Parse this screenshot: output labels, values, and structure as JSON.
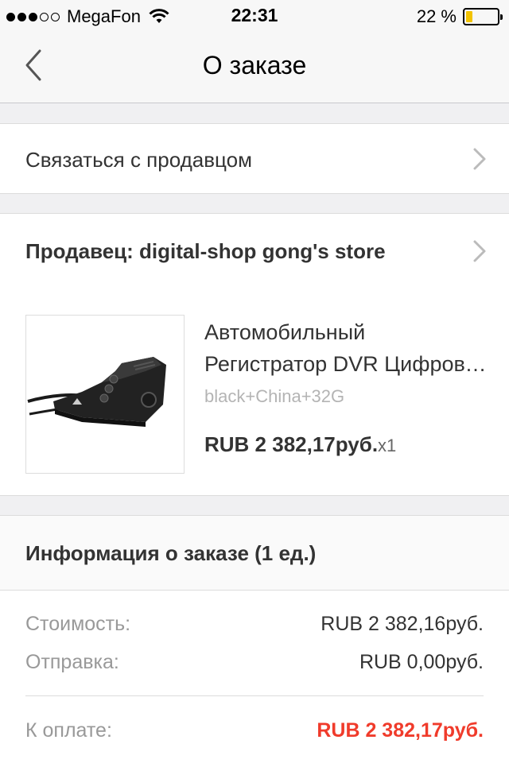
{
  "status_bar": {
    "carrier": "MegaFon",
    "time": "22:31",
    "battery_text": "22 %",
    "battery_level": 0.22,
    "signal_bars": 3,
    "signal_total": 5
  },
  "nav": {
    "title": "О заказе",
    "back_icon": "chevron-left-icon"
  },
  "contact_seller": {
    "label": "Связаться с продавцом"
  },
  "seller": {
    "label": "Продавец: digital-shop gong's store"
  },
  "product": {
    "title_line1": "Автомобильный",
    "title_line2": "Регистратор DVR Цифровой",
    "variant": "black+China+32G",
    "price": "RUB 2 382,17руб.",
    "quantity": "x1"
  },
  "order_info": {
    "header": "Информация о заказе (1 ед.)",
    "cost_label": "Стоимость:",
    "cost_value": "RUB 2 382,16руб.",
    "shipping_label": "Отправка:",
    "shipping_value": "RUB 0,00руб.",
    "total_label": "К оплате:",
    "total_value": "RUB 2 382,17руб."
  },
  "colors": {
    "accent_total": "#f03b2b",
    "battery": "#f2c300"
  }
}
